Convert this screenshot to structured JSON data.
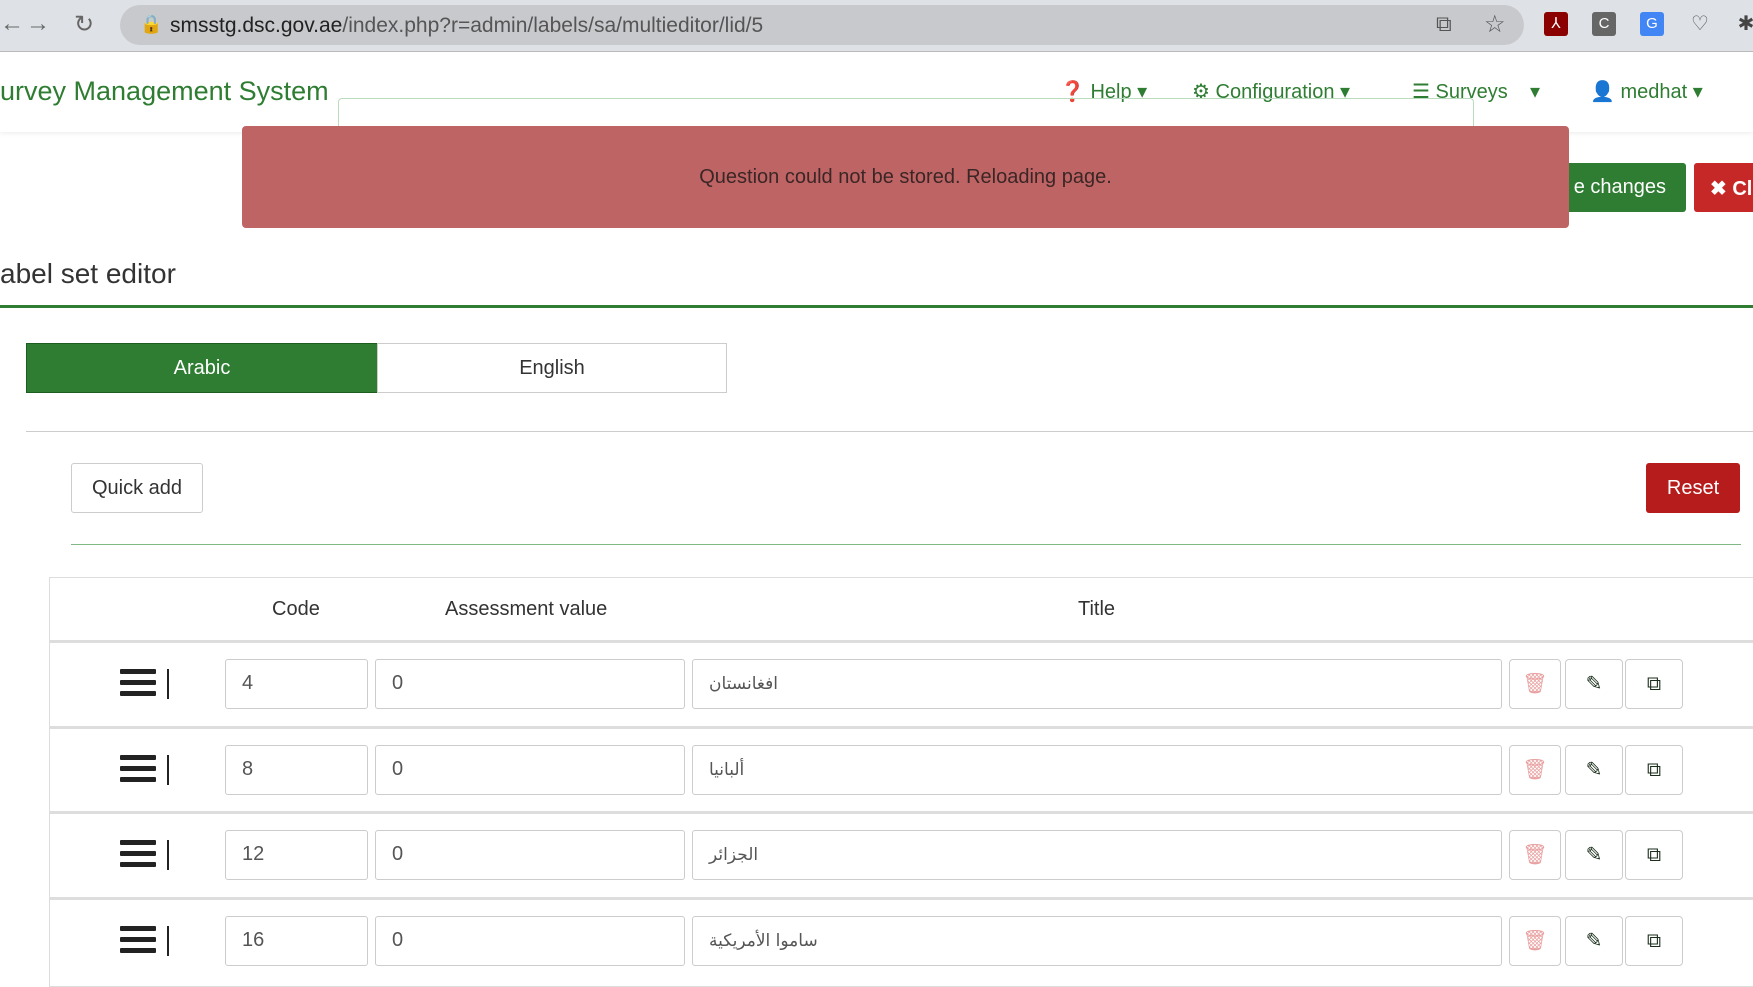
{
  "browser": {
    "url_host": "smsstg.dsc.gov.ae",
    "url_path": "/index.php?r=admin/labels/sa/multieditor/lid/5"
  },
  "header": {
    "brand": "urvey Management System",
    "nav": [
      {
        "label": "Help"
      },
      {
        "label": "Configuration"
      },
      {
        "label": "Surveys"
      },
      {
        "label": "medhat"
      }
    ]
  },
  "alert": {
    "message": "Question could not be stored. Reloading page."
  },
  "toolbar": {
    "save_label": "e changes",
    "close_label": "✖ Cl"
  },
  "page": {
    "title": "abel set editor"
  },
  "tabs": [
    {
      "label": "Arabic",
      "active": true
    },
    {
      "label": "English",
      "active": false
    }
  ],
  "actions": {
    "quick_add": "Quick add",
    "reset": "Reset"
  },
  "table": {
    "headers": {
      "code": "Code",
      "assessment": "Assessment value",
      "title": "Title"
    },
    "rows": [
      {
        "code": "4",
        "assessment": "0",
        "title": "افغانستان"
      },
      {
        "code": "8",
        "assessment": "0",
        "title": "ألبانيا"
      },
      {
        "code": "12",
        "assessment": "0",
        "title": "الجزائر"
      },
      {
        "code": "16",
        "assessment": "0",
        "title": "ساموا الأمريكية"
      }
    ]
  },
  "colors": {
    "brand": "#2e7d32",
    "alert": "#bf6464",
    "danger": "#b71c1c"
  }
}
